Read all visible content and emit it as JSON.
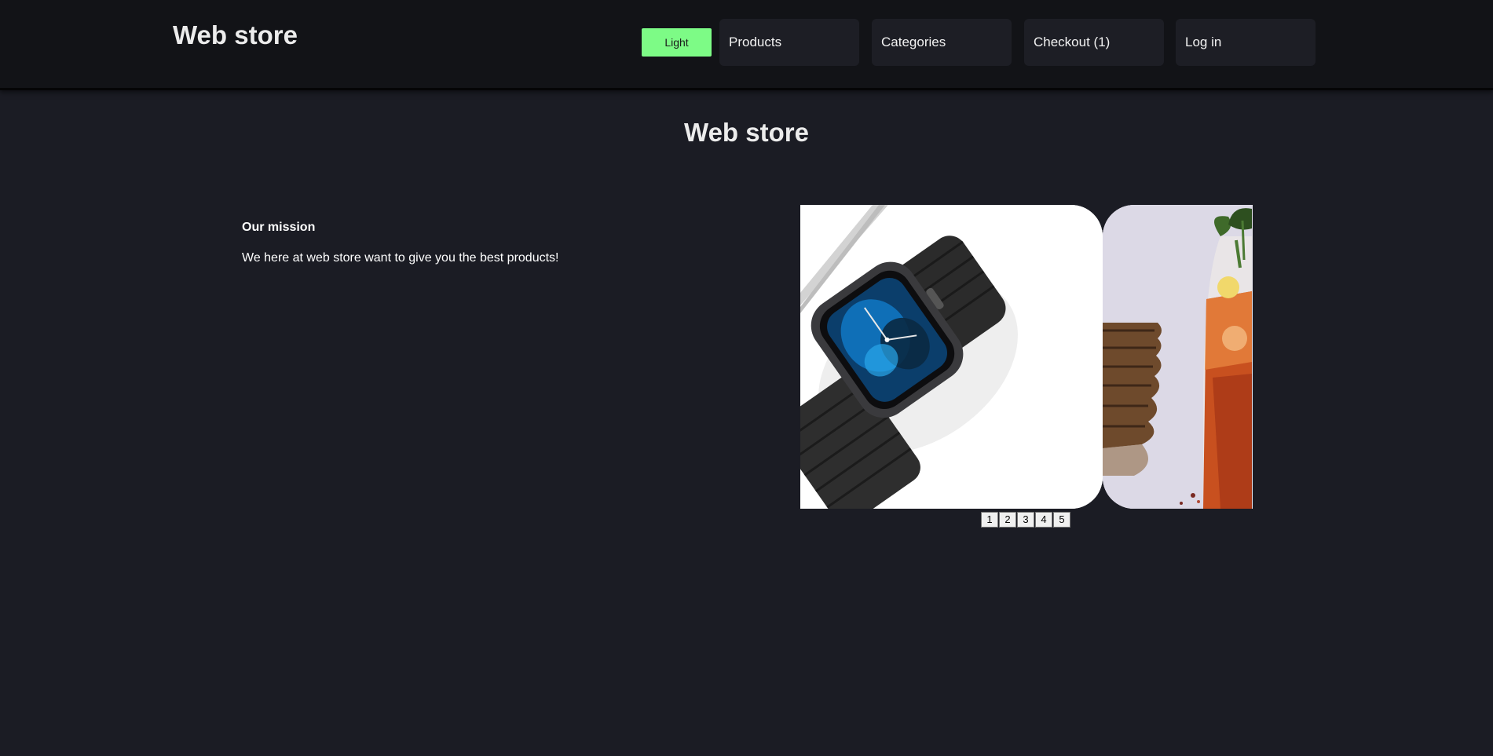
{
  "header": {
    "brand": "Web store",
    "theme_toggle_label": "Light",
    "nav": {
      "products": "Products",
      "categories": "Categories",
      "checkout": "Checkout (1)",
      "login": "Log in"
    }
  },
  "main": {
    "title": "Web store",
    "mission_heading": "Our mission",
    "mission_text": "We here at web store want to give you the best products!"
  },
  "carousel": {
    "pages": [
      "1",
      "2",
      "3",
      "4",
      "5"
    ]
  },
  "colors": {
    "background": "#1b1c24",
    "header": "#121317",
    "nav_item": "#1d1e25",
    "accent_toggle": "#7dfb86"
  }
}
